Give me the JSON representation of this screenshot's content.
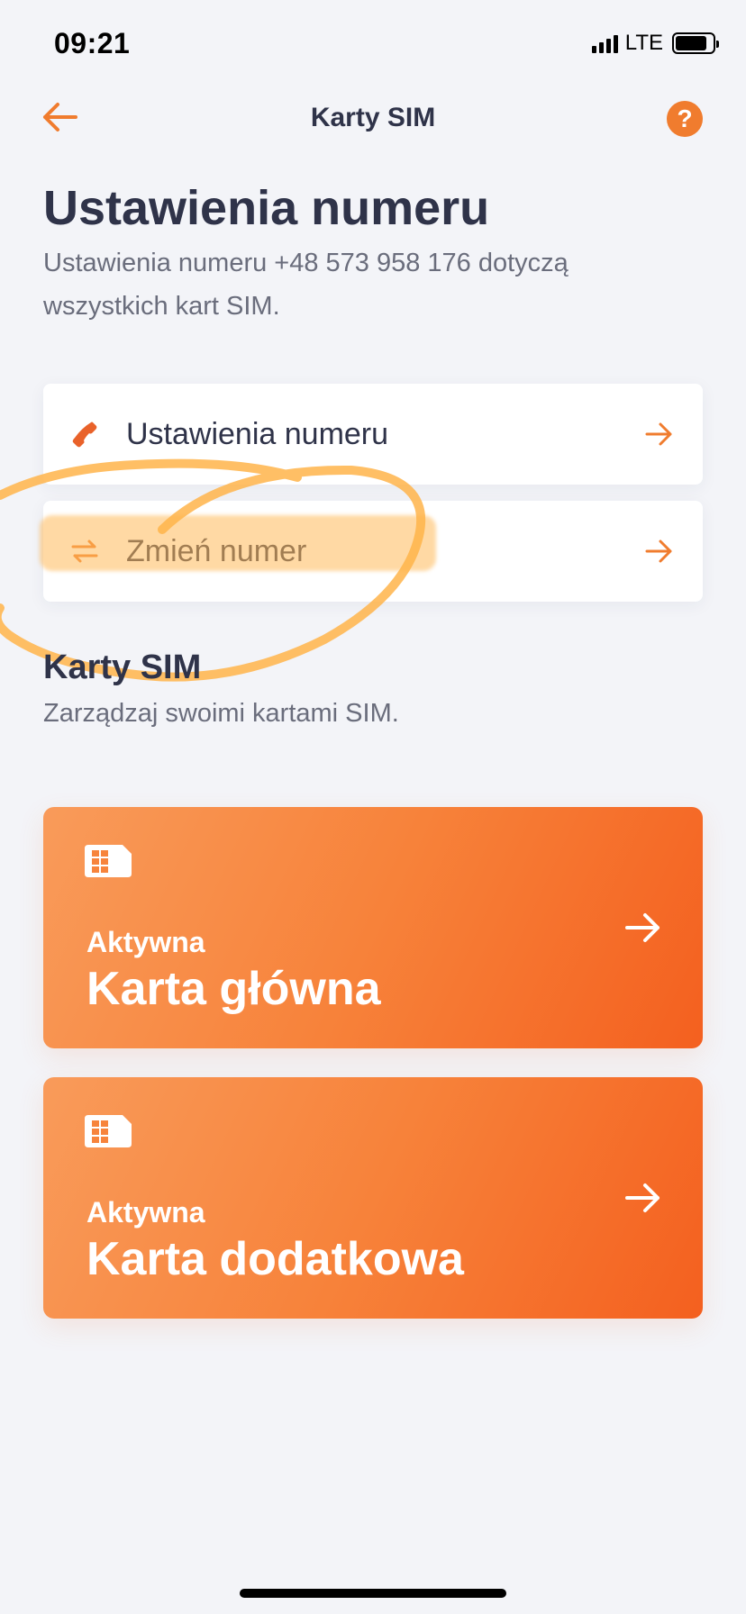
{
  "status_bar": {
    "time": "09:21",
    "network": "LTE",
    "battery_level": 0.85
  },
  "nav": {
    "title": "Karty SIM",
    "help_label": "?"
  },
  "header": {
    "title": "Ustawienia numeru",
    "description": "Ustawienia numeru +48 573 958 176 dotyczą wszystkich kart SIM."
  },
  "menu": [
    {
      "label": "Ustawienia numeru",
      "icon": "phone-icon"
    },
    {
      "label": "Zmień numer",
      "icon": "swap-arrows-icon"
    }
  ],
  "sim_section": {
    "title": "Karty SIM",
    "description": "Zarządzaj swoimi kartami SIM."
  },
  "sim_cards": [
    {
      "status": "Aktywna",
      "name": "Karta główna"
    },
    {
      "status": "Aktywna",
      "name": "Karta dodatkowa"
    }
  ],
  "colors": {
    "accent": "#f07c2e",
    "text_dark": "#2f3349",
    "text_muted": "#6a6d7c",
    "background": "#f3f4f8",
    "annotation": "#ffb44a"
  }
}
